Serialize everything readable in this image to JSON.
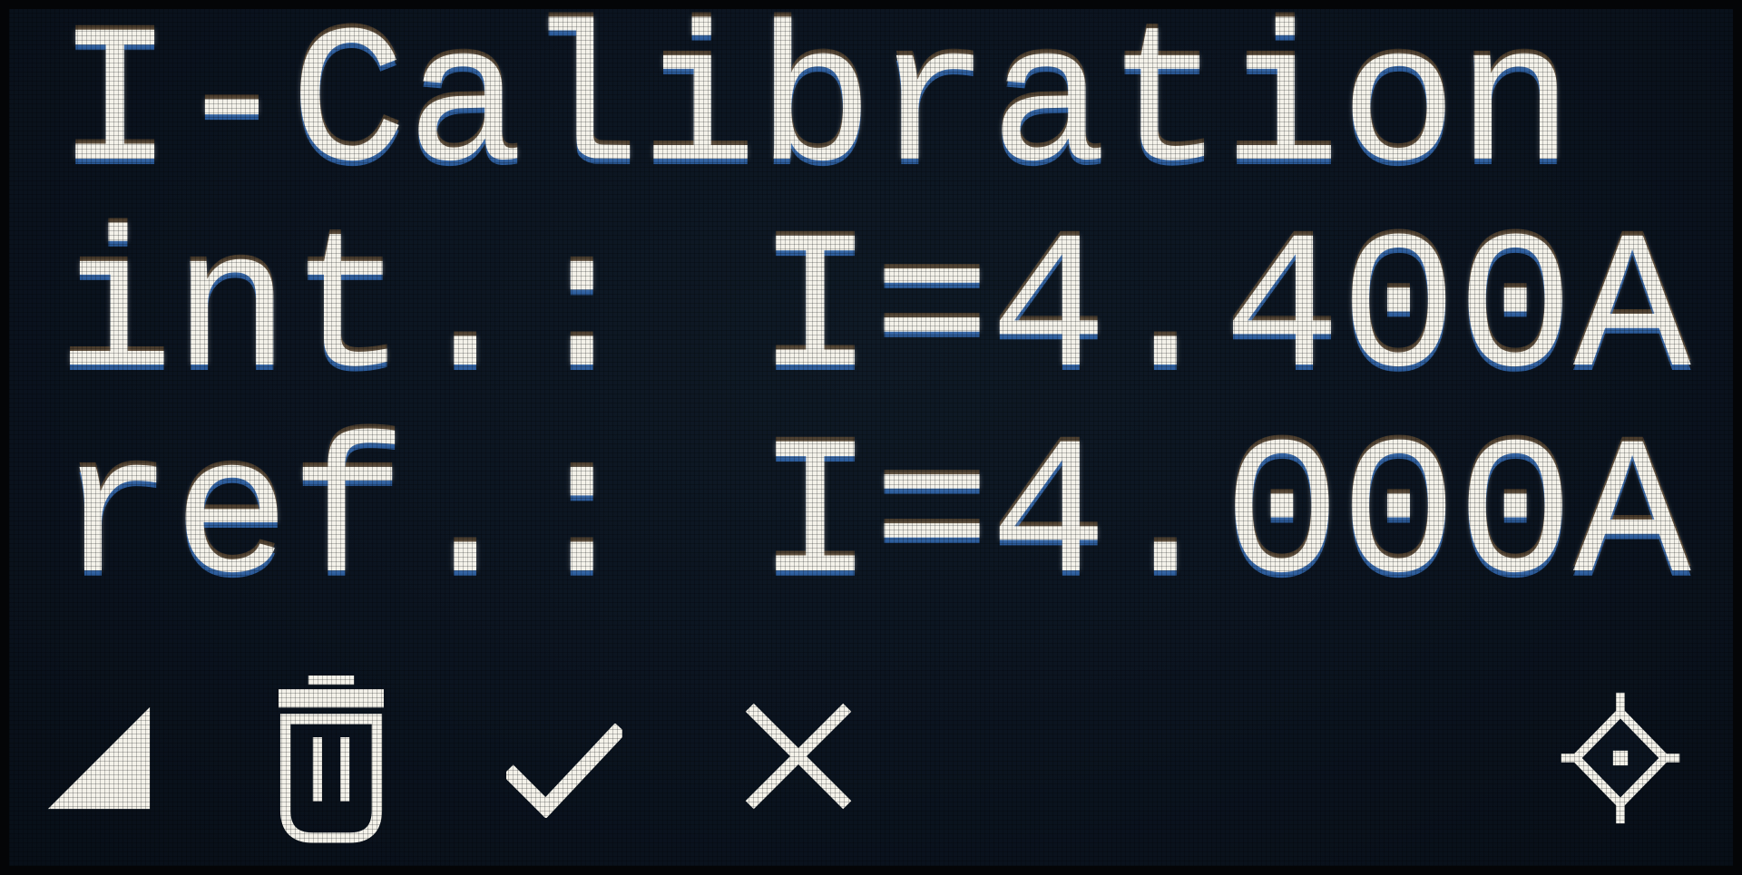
{
  "display": {
    "title": "I-Calibration",
    "rows": [
      {
        "label": "int.:",
        "value": "I=4.400A"
      },
      {
        "label": "ref.:",
        "value": "I=4.000A"
      }
    ],
    "row_text": {
      "int": "int.: I=4.400A",
      "ref": "ref.: I=4.000A"
    }
  },
  "icons": [
    {
      "name": "signal-strength-icon"
    },
    {
      "name": "trash-icon"
    },
    {
      "name": "check-icon"
    },
    {
      "name": "close-icon"
    },
    {
      "name": "crosshair-target-icon"
    }
  ],
  "colors": {
    "background": "#0b1420",
    "foreground": "#f4f2ea"
  }
}
